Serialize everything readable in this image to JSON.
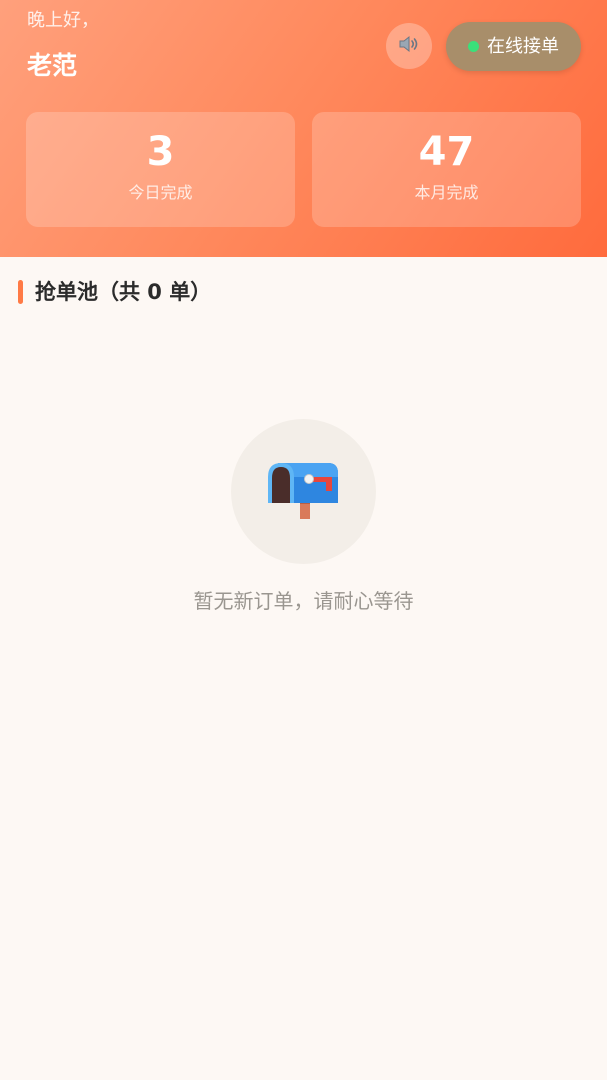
{
  "header": {
    "greeting": "晚上好，",
    "username": "老范",
    "sound_icon": "speaker-icon",
    "status_label": "在线接单",
    "status_color": "#3be07a"
  },
  "stats": [
    {
      "value": "3",
      "label": "今日完成"
    },
    {
      "value": "47",
      "label": "本月完成"
    }
  ],
  "pool": {
    "title": "抢单池（共 0 单）",
    "empty_icon": "mailbox-icon",
    "empty_text": "暂无新订单，请耐心等待"
  },
  "colors": {
    "accent": "#ff7a45",
    "header_start": "#ffa07c",
    "header_end": "#ff6b3d",
    "background": "#fdf8f4"
  }
}
